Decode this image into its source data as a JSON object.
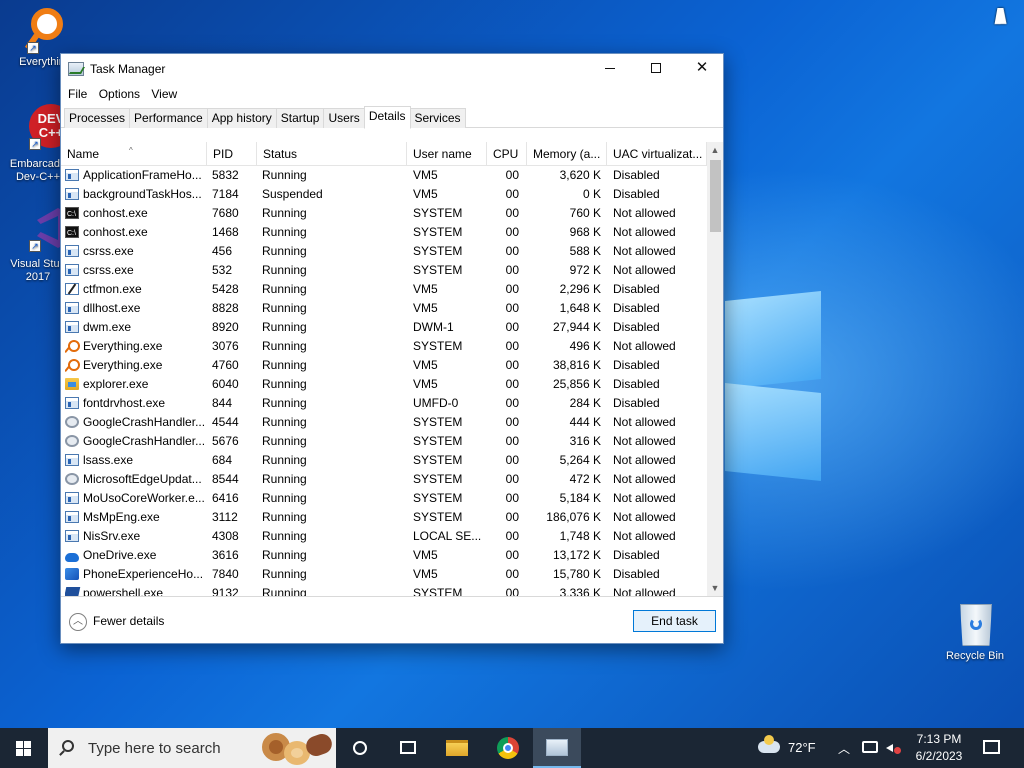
{
  "desktop": {
    "icons": [
      {
        "label": "Everything",
        "icon": "everything-icon"
      },
      {
        "label": "Embarcadero Dev-C++",
        "icon": "devcpp-icon"
      },
      {
        "label": "Visual Studio 2017",
        "icon": "visual-studio-icon"
      },
      {
        "label": "Recycle Bin",
        "icon": "recycle-bin-icon"
      }
    ],
    "icon_text": {
      "everything": "Everythin",
      "devcpp_line1": "Embarcade",
      "devcpp_line2": "Dev-C++",
      "vs_line1": "Visual Stud",
      "vs_line2": "2017",
      "recycle": "Recycle Bin",
      "devcpp_logo_top": "DEV",
      "devcpp_logo_bottom": "C++"
    }
  },
  "window": {
    "title": "Task Manager",
    "controls": {
      "minimize": "—",
      "close": "✕"
    },
    "menu": [
      "File",
      "Options",
      "View"
    ],
    "tabs": [
      "Processes",
      "Performance",
      "App history",
      "Startup",
      "Users",
      "Details",
      "Services"
    ],
    "active_tab": "Details",
    "columns": [
      "Name",
      "PID",
      "Status",
      "User name",
      "CPU",
      "Memory (a...",
      "UAC virtualizat..."
    ],
    "sort_indicator": "^",
    "rows": [
      {
        "icon": "app",
        "name": "ApplicationFrameHo...",
        "pid": "5832",
        "status": "Running",
        "user": "VM5",
        "cpu": "00",
        "mem": "3,620 K",
        "uac": "Disabled"
      },
      {
        "icon": "app",
        "name": "backgroundTaskHos...",
        "pid": "7184",
        "status": "Suspended",
        "user": "VM5",
        "cpu": "00",
        "mem": "0 K",
        "uac": "Disabled"
      },
      {
        "icon": "cmd",
        "name": "conhost.exe",
        "pid": "7680",
        "status": "Running",
        "user": "SYSTEM",
        "cpu": "00",
        "mem": "760 K",
        "uac": "Not allowed"
      },
      {
        "icon": "cmd",
        "name": "conhost.exe",
        "pid": "1468",
        "status": "Running",
        "user": "SYSTEM",
        "cpu": "00",
        "mem": "968 K",
        "uac": "Not allowed"
      },
      {
        "icon": "app",
        "name": "csrss.exe",
        "pid": "456",
        "status": "Running",
        "user": "SYSTEM",
        "cpu": "00",
        "mem": "588 K",
        "uac": "Not allowed"
      },
      {
        "icon": "app",
        "name": "csrss.exe",
        "pid": "532",
        "status": "Running",
        "user": "SYSTEM",
        "cpu": "00",
        "mem": "972 K",
        "uac": "Not allowed"
      },
      {
        "icon": "pen",
        "name": "ctfmon.exe",
        "pid": "5428",
        "status": "Running",
        "user": "VM5",
        "cpu": "00",
        "mem": "2,296 K",
        "uac": "Disabled"
      },
      {
        "icon": "app",
        "name": "dllhost.exe",
        "pid": "8828",
        "status": "Running",
        "user": "VM5",
        "cpu": "00",
        "mem": "1,648 K",
        "uac": "Disabled"
      },
      {
        "icon": "app",
        "name": "dwm.exe",
        "pid": "8920",
        "status": "Running",
        "user": "DWM-1",
        "cpu": "00",
        "mem": "27,944 K",
        "uac": "Disabled"
      },
      {
        "icon": "key",
        "name": "Everything.exe",
        "pid": "3076",
        "status": "Running",
        "user": "SYSTEM",
        "cpu": "00",
        "mem": "496 K",
        "uac": "Not allowed"
      },
      {
        "icon": "key",
        "name": "Everything.exe",
        "pid": "4760",
        "status": "Running",
        "user": "VM5",
        "cpu": "00",
        "mem": "38,816 K",
        "uac": "Disabled"
      },
      {
        "icon": "folder",
        "name": "explorer.exe",
        "pid": "6040",
        "status": "Running",
        "user": "VM5",
        "cpu": "00",
        "mem": "25,856 K",
        "uac": "Disabled"
      },
      {
        "icon": "app",
        "name": "fontdrvhost.exe",
        "pid": "844",
        "status": "Running",
        "user": "UMFD-0",
        "cpu": "00",
        "mem": "284 K",
        "uac": "Disabled"
      },
      {
        "icon": "gear",
        "name": "GoogleCrashHandler...",
        "pid": "4544",
        "status": "Running",
        "user": "SYSTEM",
        "cpu": "00",
        "mem": "444 K",
        "uac": "Not allowed"
      },
      {
        "icon": "gear",
        "name": "GoogleCrashHandler...",
        "pid": "5676",
        "status": "Running",
        "user": "SYSTEM",
        "cpu": "00",
        "mem": "316 K",
        "uac": "Not allowed"
      },
      {
        "icon": "app",
        "name": "lsass.exe",
        "pid": "684",
        "status": "Running",
        "user": "SYSTEM",
        "cpu": "00",
        "mem": "5,264 K",
        "uac": "Not allowed"
      },
      {
        "icon": "gear",
        "name": "MicrosoftEdgeUpdat...",
        "pid": "8544",
        "status": "Running",
        "user": "SYSTEM",
        "cpu": "00",
        "mem": "472 K",
        "uac": "Not allowed"
      },
      {
        "icon": "app",
        "name": "MoUsoCoreWorker.e...",
        "pid": "6416",
        "status": "Running",
        "user": "SYSTEM",
        "cpu": "00",
        "mem": "5,184 K",
        "uac": "Not allowed"
      },
      {
        "icon": "app",
        "name": "MsMpEng.exe",
        "pid": "3112",
        "status": "Running",
        "user": "SYSTEM",
        "cpu": "00",
        "mem": "186,076 K",
        "uac": "Not allowed"
      },
      {
        "icon": "app",
        "name": "NisSrv.exe",
        "pid": "4308",
        "status": "Running",
        "user": "LOCAL SE...",
        "cpu": "00",
        "mem": "1,748 K",
        "uac": "Not allowed"
      },
      {
        "icon": "cloud",
        "name": "OneDrive.exe",
        "pid": "3616",
        "status": "Running",
        "user": "VM5",
        "cpu": "00",
        "mem": "13,172 K",
        "uac": "Disabled"
      },
      {
        "icon": "phone",
        "name": "PhoneExperienceHo...",
        "pid": "7840",
        "status": "Running",
        "user": "VM5",
        "cpu": "00",
        "mem": "15,780 K",
        "uac": "Disabled"
      },
      {
        "icon": "ps",
        "name": "powershell.exe",
        "pid": "9132",
        "status": "Running",
        "user": "SYSTEM",
        "cpu": "00",
        "mem": "3,336 K",
        "uac": "Not allowed"
      }
    ],
    "footer": {
      "fewer_details": "Fewer details",
      "end_task": "End task"
    }
  },
  "taskbar": {
    "search_placeholder": "Type here to search",
    "weather": "72°F",
    "time": "7:13 PM",
    "date": "6/2/2023",
    "colors": {
      "bar": "#1b2634",
      "accent": "#76b9ed"
    }
  }
}
